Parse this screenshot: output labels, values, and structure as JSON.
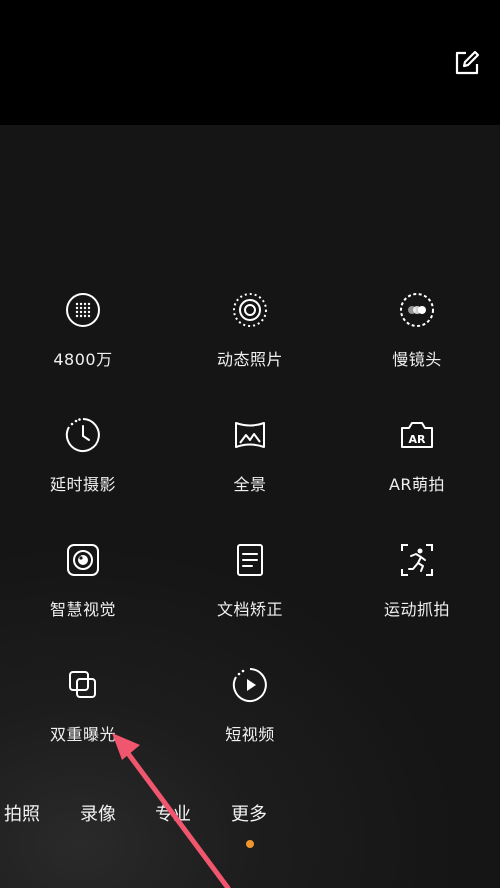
{
  "header": {
    "edit_icon": "edit-square-icon"
  },
  "modes": [
    {
      "label": "4800万",
      "icon": "dotted-grid-circle-icon"
    },
    {
      "label": "动态照片",
      "icon": "live-photo-icon"
    },
    {
      "label": "慢镜头",
      "icon": "slow-motion-icon"
    },
    {
      "label": "延时摄影",
      "icon": "timelapse-clock-icon"
    },
    {
      "label": "全景",
      "icon": "panorama-icon"
    },
    {
      "label": "AR萌拍",
      "icon": "ar-camera-icon"
    },
    {
      "label": "智慧视觉",
      "icon": "smart-vision-icon"
    },
    {
      "label": "文档矫正",
      "icon": "document-icon"
    },
    {
      "label": "运动抓拍",
      "icon": "running-person-icon"
    },
    {
      "label": "双重曝光",
      "icon": "double-exposure-icon"
    },
    {
      "label": "短视频",
      "icon": "play-circle-icon"
    }
  ],
  "tabs": [
    "拍照",
    "录像",
    "专业",
    "更多"
  ],
  "selected_tab": "更多",
  "colors": {
    "accent": "#f0962f",
    "annotation_arrow": "#f0566e"
  }
}
